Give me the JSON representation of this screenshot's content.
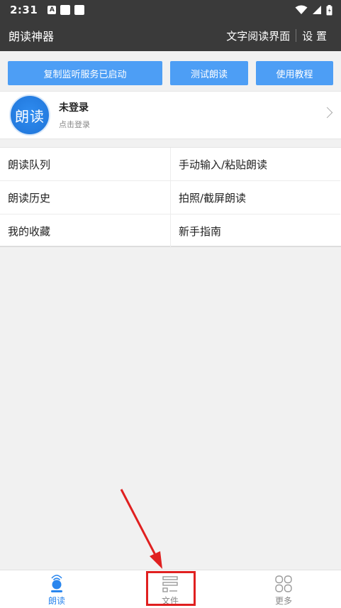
{
  "status_bar": {
    "time": "2:31",
    "a_badge": "A"
  },
  "app_bar": {
    "title": "朗读神器",
    "actions": [
      "文字阅读界面",
      "设 置"
    ]
  },
  "buttons": [
    "复制监听服务已启动",
    "测试朗读",
    "使用教程"
  ],
  "profile": {
    "avatar_text": "朗读",
    "name": "未登录",
    "subtitle": "点击登录"
  },
  "menu": [
    [
      "朗读队列",
      "手动输入/粘贴朗读"
    ],
    [
      "朗读历史",
      "拍照/截屏朗读"
    ],
    [
      "我的收藏",
      "新手指南"
    ]
  ],
  "tabs": [
    {
      "label": "朗读",
      "icon": "speaker-mic-icon",
      "active": true
    },
    {
      "label": "文件",
      "icon": "file-icon",
      "active": false
    },
    {
      "label": "更多",
      "icon": "grid-more-icon",
      "active": false
    }
  ],
  "colors": {
    "bar": "#3a3a3a",
    "button": "#4d9ef5",
    "active_tab": "#2a86ee",
    "annotation": "#e02020"
  }
}
